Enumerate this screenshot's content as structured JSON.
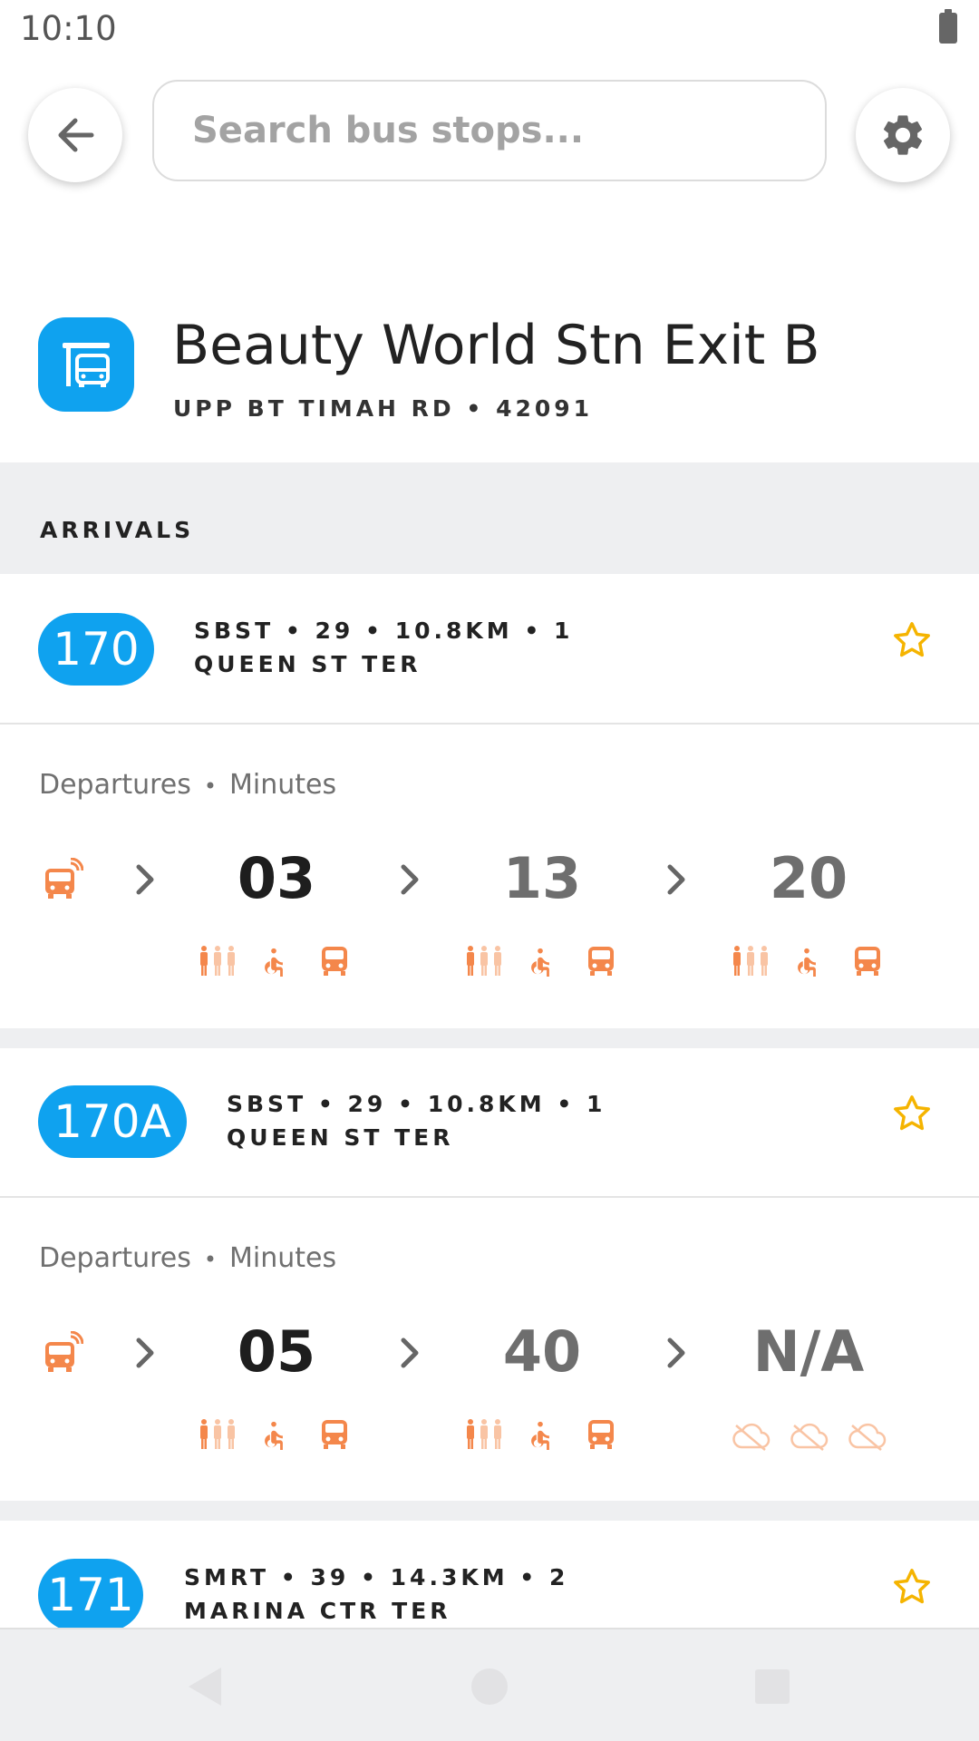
{
  "status_bar": {
    "time": "10:10"
  },
  "search": {
    "placeholder": "Search bus stops..."
  },
  "stop": {
    "name": "Beauty World Stn Exit B",
    "road": "UPP BT TIMAH RD",
    "code": "42091"
  },
  "section_label": "ARRIVALS",
  "departures_label": "Departures",
  "minutes_label": "Minutes",
  "services": [
    {
      "number": "170",
      "operator": "SBST",
      "stops": "29",
      "distance": "10.8KM",
      "direction": "1",
      "destination": "QUEEN ST TER",
      "arrivals": [
        "03",
        "13",
        "20"
      ]
    },
    {
      "number": "170A",
      "operator": "SBST",
      "stops": "29",
      "distance": "10.8KM",
      "direction": "1",
      "destination": "QUEEN ST TER",
      "arrivals": [
        "05",
        "40",
        "N/A"
      ]
    },
    {
      "number": "171",
      "operator": "SMRT",
      "stops": "39",
      "distance": "14.3KM",
      "direction": "2",
      "destination": "MARINA CTR TER"
    }
  ],
  "colors": {
    "accent": "#0fa2ef",
    "bus_orange": "#f4874b",
    "bus_orange_faded": "#f9c4a4",
    "star": "#f5b400"
  },
  "icons": [
    "back-arrow-icon",
    "gear-icon",
    "bus-stop-icon",
    "star-outline-icon",
    "bus-live-icon",
    "chevron-right-icon",
    "standing-load-icon",
    "wheelchair-icon",
    "single-deck-bus-icon",
    "no-data-cloud-icon"
  ]
}
